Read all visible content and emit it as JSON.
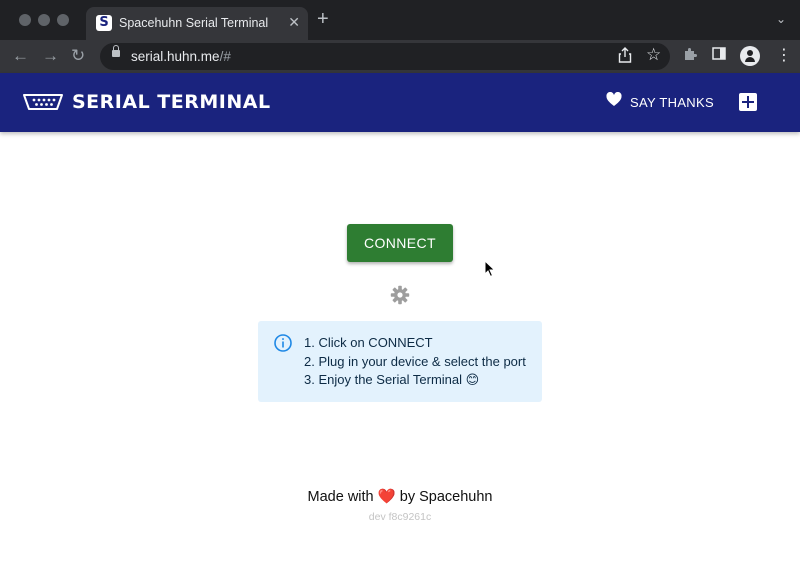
{
  "browser": {
    "tab_title": "Spacehuhn Serial Terminal",
    "favicon_letter": "S",
    "url_host": "serial.huhn.me",
    "url_path": "/#"
  },
  "app": {
    "title": "SERIAL TERMINAL",
    "say_thanks_label": "SAY THANKS",
    "brand_color": "#1a237e"
  },
  "main": {
    "connect_label": "CONNECT",
    "connect_color": "#2e7d32",
    "info": {
      "lines": [
        "1. Click on CONNECT",
        "2. Plug in your device & select the port",
        "3. Enjoy the Serial Terminal 😊"
      ],
      "background": "#e3f2fd"
    }
  },
  "footer": {
    "made_with_prefix": "Made with",
    "heart": "❤️",
    "made_with_suffix": "by Spacehuhn",
    "version": "dev f8c9261c"
  },
  "icons": [
    "serial-port-icon",
    "heart-icon",
    "add-icon",
    "gear-icon",
    "info-icon"
  ]
}
